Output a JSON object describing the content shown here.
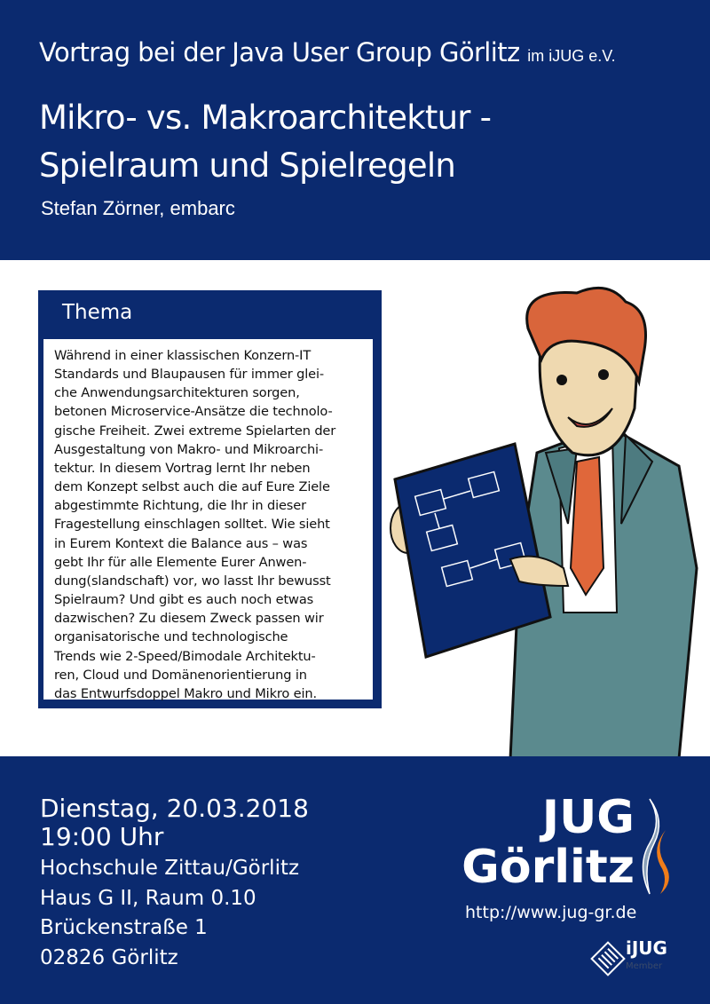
{
  "header": {
    "event": "Vortrag bei der Java User Group Görlitz",
    "event_suffix": "im iJUG e.V.",
    "title_line1": "Mikro- vs. Makroarchitektur -",
    "title_line2": "Spielraum und Spielregeln",
    "speaker": "Stefan Zörner, embarc"
  },
  "thema": {
    "heading": "Thema",
    "lines": [
      "Während in einer klassischen Konzern-IT",
      "Standards und Blaupausen für immer glei-",
      "che Anwendungsarchitekturen sorgen,",
      "betonen Microservice-Ansätze die technolo-",
      "gische Freiheit. Zwei extreme Spielarten der",
      "Ausgestaltung von Makro- und Mikroarchi-",
      "tektur. In diesem Vortrag lernt Ihr neben",
      "dem Konzept selbst auch die auf Eure Ziele",
      "abgestimmte Richtung, die Ihr in dieser",
      "Fragestellung einschlagen solltet. Wie sieht",
      "in Eurem Kontext die Balance aus – was",
      "gebt Ihr für alle Elemente Eurer Anwen-",
      "dung(slandschaft) vor, wo lasst Ihr bewusst",
      "Spielraum? Und gibt es auch noch etwas",
      "dazwischen? Zu diesem Zweck passen wir",
      "organisatorische und technologische",
      "Trends wie 2-Speed/Bimodale Architektu-",
      "ren, Cloud und Domänenorientierung in",
      "das Entwurfsdoppel Makro und Mikro ein."
    ]
  },
  "event_info": {
    "date": "Dienstag, 20.03.2018",
    "time": "19:00 Uhr",
    "address": [
      "Hochschule Zittau/Görlitz",
      "Haus G II, Raum 0.10",
      "Brückenstraße 1",
      "02826 Görlitz"
    ]
  },
  "logo": {
    "line1": "JUG",
    "line2": "Görlitz",
    "url": "http://www.jug-gr.de",
    "ijug": "iJUG",
    "member": "Member"
  },
  "colors": {
    "navy": "#0b2a6f",
    "orange": "#f07d1a",
    "hair": "#d9653b",
    "suit": "#5b8a8e"
  }
}
